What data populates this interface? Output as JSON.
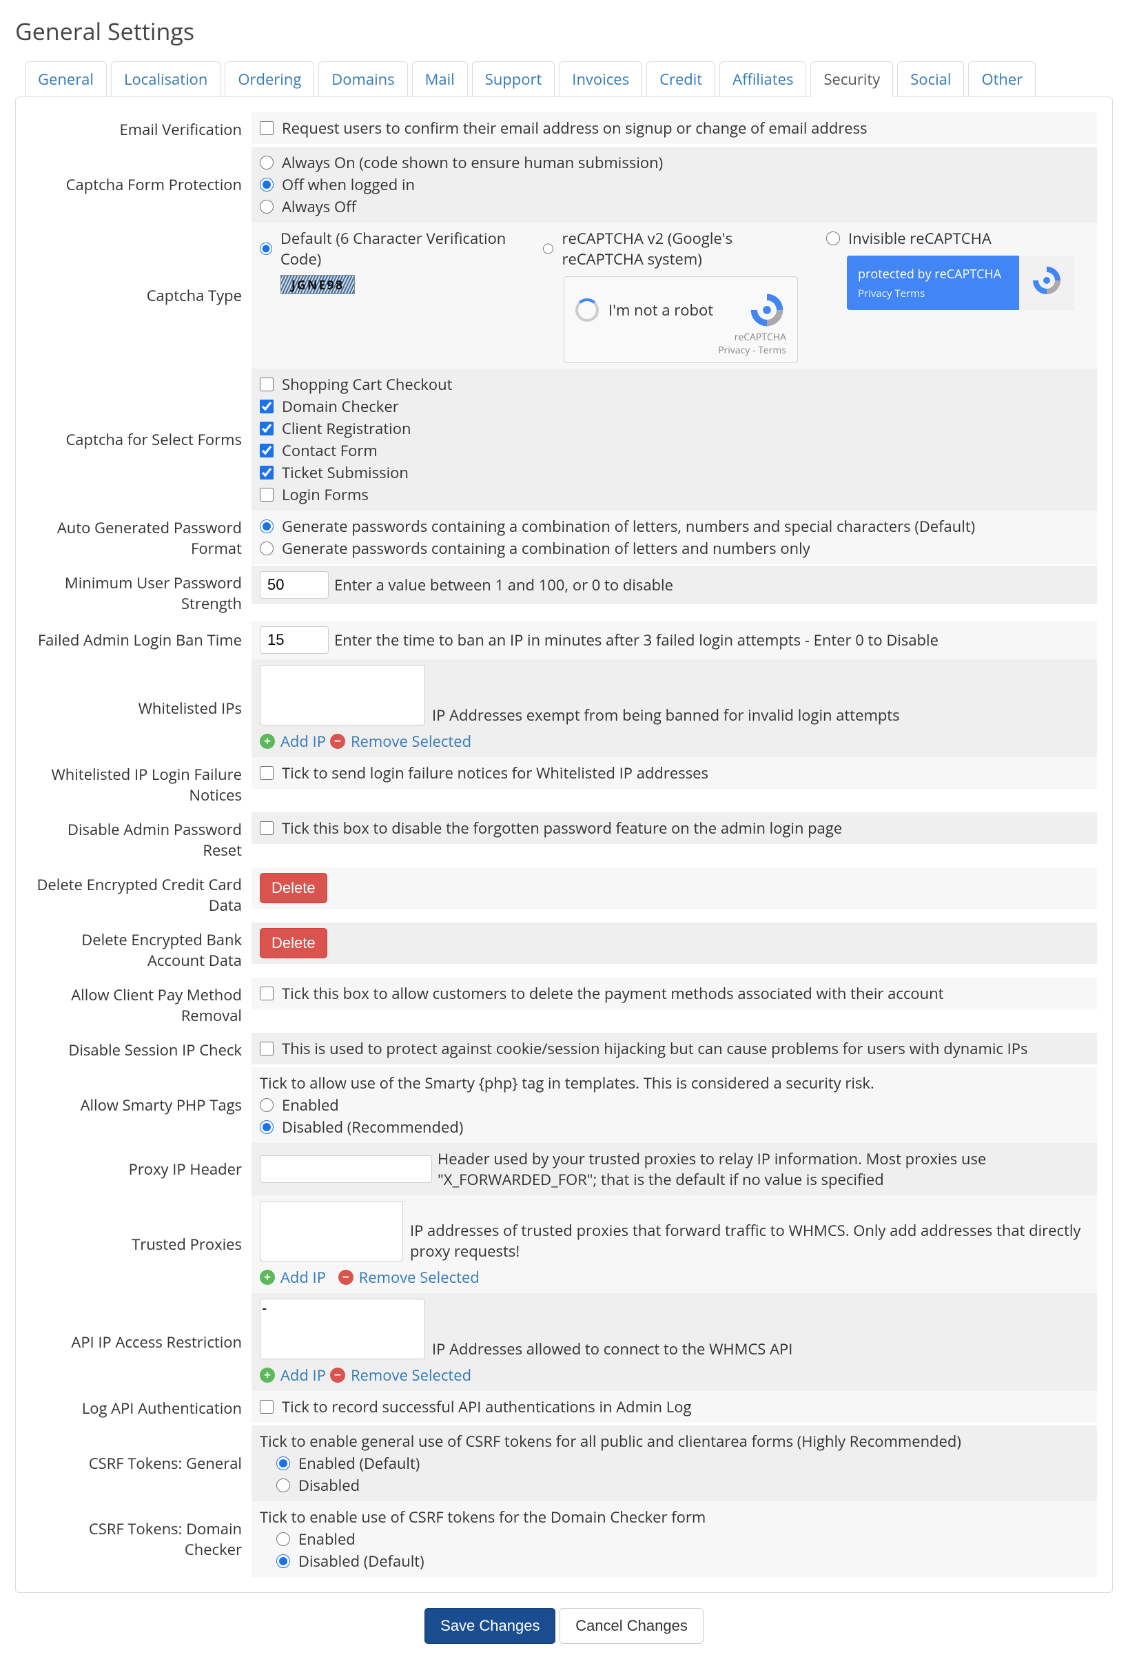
{
  "page_title": "General Settings",
  "tabs": [
    "General",
    "Localisation",
    "Ordering",
    "Domains",
    "Mail",
    "Support",
    "Invoices",
    "Credit",
    "Affiliates",
    "Security",
    "Social",
    "Other"
  ],
  "active_tab": "Security",
  "rows": {
    "email_verification": {
      "label": "Email Verification",
      "text": "Request users to confirm their email address on signup or change of email address"
    },
    "captcha_protection": {
      "label": "Captcha Form Protection",
      "opts": [
        "Always On (code shown to ensure human submission)",
        "Off when logged in",
        "Always Off"
      ]
    },
    "captcha_type": {
      "label": "Captcha Type",
      "default_label": "Default (6 Character Verification Code)",
      "default_code": "JGNE98",
      "v2_label": "reCAPTCHA v2 (Google's reCAPTCHA system)",
      "v2_text": "I'm not a robot",
      "v2_brand": "reCAPTCHA",
      "v2_terms": "Privacy - Terms",
      "invis_label": "Invisible reCAPTCHA",
      "invis_line1": "protected by reCAPTCHA",
      "invis_line2": "Privacy   Terms"
    },
    "captcha_forms": {
      "label": "Captcha for Select Forms",
      "items": [
        "Shopping Cart Checkout",
        "Domain Checker",
        "Client Registration",
        "Contact Form",
        "Ticket Submission",
        "Login Forms"
      ],
      "checked": [
        false,
        true,
        true,
        true,
        true,
        false
      ]
    },
    "auto_pwd": {
      "label": "Auto Generated Password Format",
      "opts": [
        "Generate passwords containing a combination of letters, numbers and special characters (Default)",
        "Generate passwords containing a combination of letters and numbers only"
      ]
    },
    "min_pwd": {
      "label": "Minimum User Password Strength",
      "value": "50",
      "hint": "Enter a value between 1 and 100, or 0 to disable"
    },
    "failed_ban": {
      "label": "Failed Admin Login Ban Time",
      "value": "15",
      "hint": "Enter the time to ban an IP in minutes after 3 failed login attempts - Enter 0 to Disable"
    },
    "whitelisted_ips": {
      "label": "Whitelisted IPs",
      "hint": "IP Addresses exempt from being banned for invalid login attempts",
      "add": "Add IP",
      "remove": "Remove Selected"
    },
    "whitelisted_notice": {
      "label": "Whitelisted IP Login Failure Notices",
      "text": "Tick to send login failure notices for Whitelisted IP addresses"
    },
    "disable_pwd_reset": {
      "label": "Disable Admin Password Reset",
      "text": "Tick this box to disable the forgotten password feature on the admin login page"
    },
    "delete_cc": {
      "label": "Delete Encrypted Credit Card Data",
      "btn": "Delete"
    },
    "delete_bank": {
      "label": "Delete Encrypted Bank Account Data",
      "btn": "Delete"
    },
    "allow_pay_removal": {
      "label": "Allow Client Pay Method Removal",
      "text": "Tick this box to allow customers to delete the payment methods associated with their account"
    },
    "disable_session_ip": {
      "label": "Disable Session IP Check",
      "text": "This is used to protect against cookie/session hijacking but can cause problems for users with dynamic IPs"
    },
    "smarty_php": {
      "label": "Allow Smarty PHP Tags",
      "hint": "Tick to allow use of the Smarty {php} tag in templates. This is considered a security risk.",
      "opts": [
        "Enabled",
        "Disabled (Recommended)"
      ]
    },
    "proxy_header": {
      "label": "Proxy IP Header",
      "hint": "Header used by your trusted proxies to relay IP information. Most proxies use \"X_FORWARDED_FOR\"; that is the default if no value is specified"
    },
    "trusted_proxies": {
      "label": "Trusted Proxies",
      "hint": "IP addresses of trusted proxies that forward traffic to WHMCS. Only add addresses that directly proxy requests!",
      "add": "Add IP",
      "remove": "Remove Selected"
    },
    "api_ip": {
      "label": "API IP Access Restriction",
      "hint": "IP Addresses allowed to connect to the WHMCS API",
      "item": "-",
      "add": "Add IP",
      "remove": "Remove Selected"
    },
    "log_api": {
      "label": "Log API Authentication",
      "text": "Tick to record successful API authentications in Admin Log"
    },
    "csrf_general": {
      "label": "CSRF Tokens: General",
      "hint": "Tick to enable general use of CSRF tokens for all public and clientarea forms (Highly Recommended)",
      "opts": [
        "Enabled (Default)",
        "Disabled"
      ]
    },
    "csrf_domain": {
      "label": "CSRF Tokens: Domain Checker",
      "hint": "Tick to enable use of CSRF tokens for the Domain Checker form",
      "opts": [
        "Enabled",
        "Disabled (Default)"
      ]
    }
  },
  "footer": {
    "save": "Save Changes",
    "cancel": "Cancel Changes"
  }
}
